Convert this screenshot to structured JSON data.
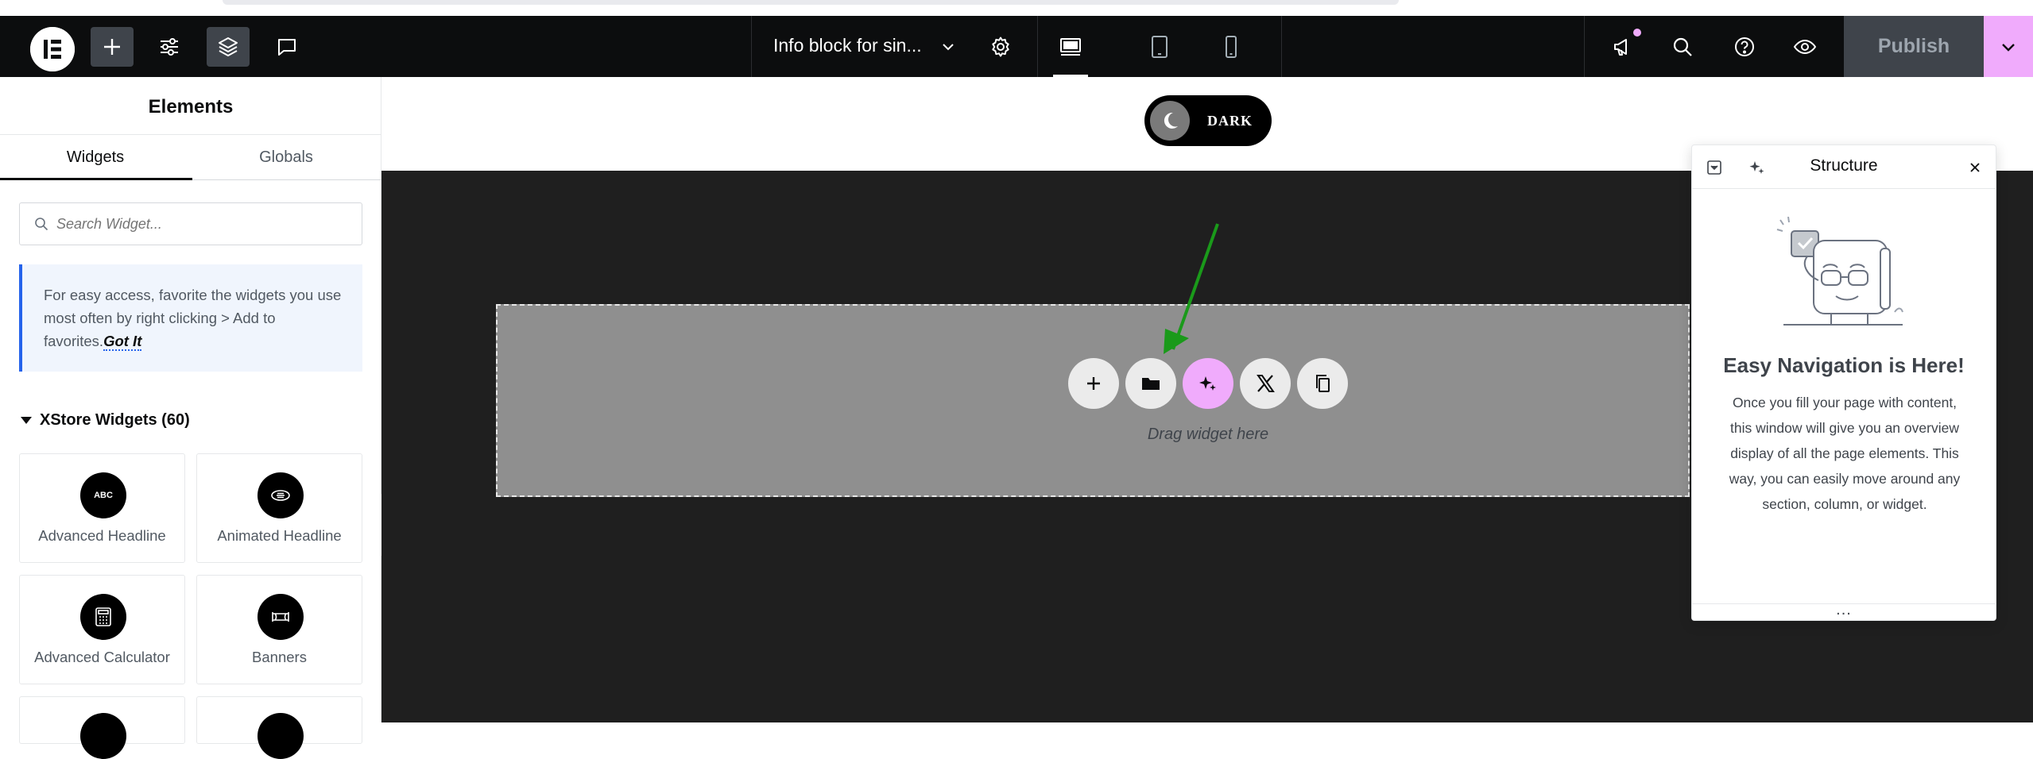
{
  "topbar": {
    "document_title": "Info block for sin...",
    "publish_label": "Publish",
    "buttons": [
      "elementor-logo",
      "add-element",
      "site-settings",
      "structure",
      "notes"
    ]
  },
  "panel": {
    "title": "Elements",
    "tabs": [
      {
        "label": "Widgets",
        "active": true
      },
      {
        "label": "Globals",
        "active": false
      }
    ],
    "search_placeholder": "Search Widget...",
    "notice_text": "For easy access, favorite the widgets you use most often by right clicking > Add to favorites.",
    "notice_link": "Got It",
    "category": "XStore Widgets (60)",
    "widgets": [
      {
        "label": "Advanced Headline",
        "icon": "abc-icon",
        "icon_text": "ABC"
      },
      {
        "label": "Animated Headline",
        "icon": "animated-headline-icon"
      },
      {
        "label": "Advanced Calculator",
        "icon": "calculator-icon"
      },
      {
        "label": "Banners",
        "icon": "banner-icon"
      }
    ]
  },
  "canvas": {
    "dark_toggle_label": "DARK",
    "drop_text": "Drag widget here"
  },
  "structure": {
    "title": "Structure",
    "heading": "Easy Navigation is Here!",
    "body": "Once you fill your page with content, this window will give you an overview display of all the page elements. This way, you can easily move around any section, column, or widget.",
    "footer_dots": "..."
  },
  "colors": {
    "topbar_bg": "#0c0d0e",
    "accent_pink": "#f0abfc",
    "canvas_dark": "#1f1f1f",
    "dropzone": "#8f8f8f",
    "notice_border": "#2563eb",
    "annotation_arrow": "#1a9a1a"
  }
}
